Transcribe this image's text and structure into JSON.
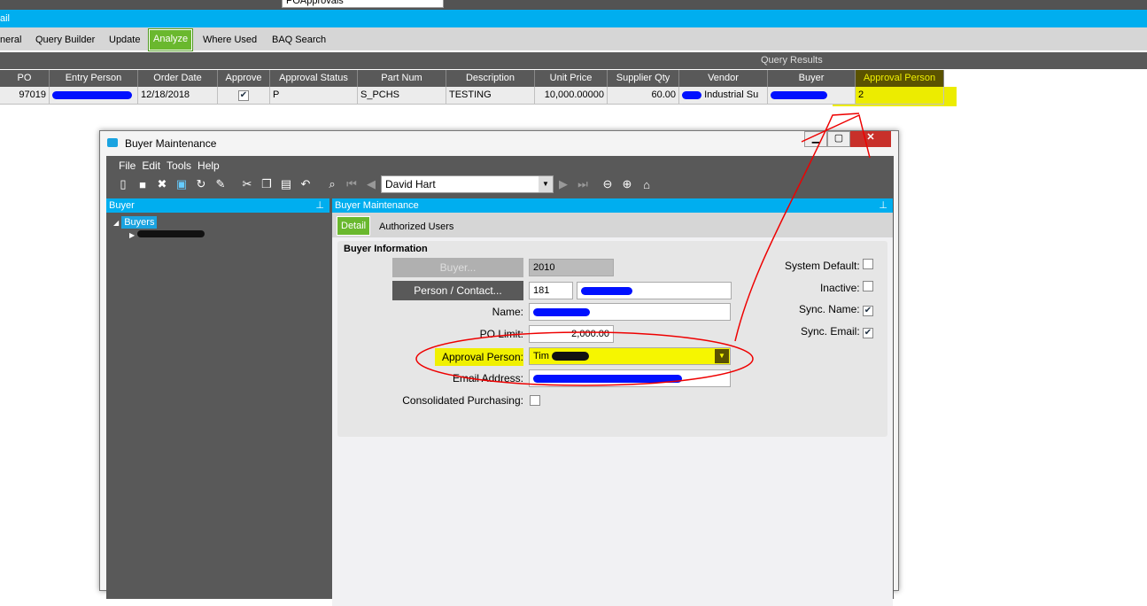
{
  "app": {
    "query_combo": "POApprovals",
    "blue_title": "ail"
  },
  "tabs": [
    "neral",
    "Query Builder",
    "Update",
    "Analyze",
    "Where Used",
    "BAQ Search"
  ],
  "results": {
    "title": "Query Results",
    "columns": [
      "PO",
      "Entry Person",
      "Order Date",
      "Approve",
      "Approval Status",
      "Part Num",
      "Description",
      "Unit Price",
      "Supplier Qty",
      "Vendor",
      "Buyer",
      "Approval Person"
    ],
    "row": {
      "po": "97019",
      "order_date": "12/18/2018",
      "approve": true,
      "approval_status": "P",
      "part_num": "S_PCHS",
      "description": "TESTING",
      "unit_price": "10,000.00000",
      "supplier_qty": "60.00",
      "vendor": "Industrial Su",
      "approval_person": "2"
    }
  },
  "dialog": {
    "title": "Buyer Maintenance",
    "menu": [
      "File",
      "Edit",
      "Tools",
      "Help"
    ],
    "record_combo": "David Hart",
    "left_pane": {
      "title": "Buyer",
      "tree_root": "Buyers"
    },
    "right_pane": {
      "title": "Buyer Maintenance",
      "tabs": [
        "Detail",
        "Authorized Users"
      ]
    },
    "group_title": "Buyer Information",
    "buyer_button": "Buyer...",
    "buyer_id": "2010",
    "person_button": "Person / Contact...",
    "person_id": "181",
    "name_label": "Name:",
    "po_limit_label": "PO Limit:",
    "po_limit": "2,000.00",
    "approval_label": "Approval Person:",
    "approval_value": "Tim",
    "email_label": "Email Address:",
    "consolidated_label": "Consolidated Purchasing:",
    "checks": [
      {
        "label": "System Default:",
        "checked": false
      },
      {
        "label": "Inactive:",
        "checked": false
      },
      {
        "label": "Sync. Name:",
        "checked": true
      },
      {
        "label": "Sync. Email:",
        "checked": true
      }
    ]
  },
  "colors": {
    "accent_blue": "#00aeef",
    "active_tab": "#6ab82e",
    "highlight": "#f0f000",
    "annotation": "#e00000"
  }
}
